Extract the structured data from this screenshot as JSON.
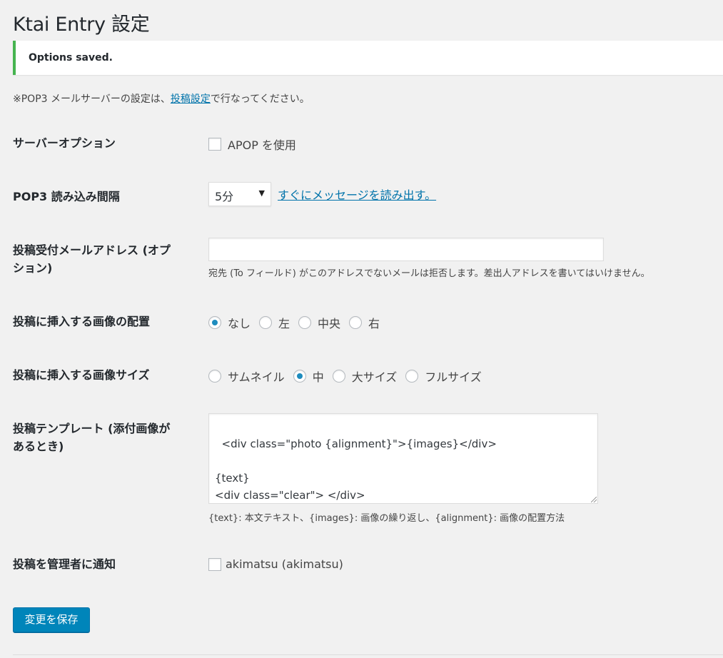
{
  "page": {
    "title": "Ktai Entry 設定"
  },
  "notice": {
    "text": "Options saved."
  },
  "intro": {
    "before": "※POP3 メールサーバーの設定は、",
    "link": "投稿設定",
    "after": "で行なってください。"
  },
  "server_options": {
    "label": "サーバーオプション",
    "apop_label": "APOP を使用",
    "apop_checked": false
  },
  "pop3_interval": {
    "label": "POP3 読み込み間隔",
    "selected": "5分",
    "read_now_link": "すぐにメッセージを読み出す。"
  },
  "post_address": {
    "label_line1": "投稿受付メールアドレス (オプ",
    "label_line2": "ション)",
    "value": "",
    "description": "宛先 (To フィールド) がこのアドレスでないメールは拒否します。差出人アドレスを書いてはいけません。"
  },
  "image_alignment": {
    "label": "投稿に挿入する画像の配置",
    "options": [
      "なし",
      "左",
      "中央",
      "右"
    ],
    "selected": "なし"
  },
  "image_size": {
    "label": "投稿に挿入する画像サイズ",
    "options": [
      "サムネイル",
      "中",
      "大サイズ",
      "フルサイズ"
    ],
    "selected": "中"
  },
  "template": {
    "label_line1": "投稿テンプレート (添付画像が",
    "label_line2": "あるとき)",
    "value": "<div class=\"photo {alignment}\">{images}</div>\n\n{text}\n<div class=\"clear\"> </div>",
    "description": "{text}: 本文テキスト、{images}: 画像の繰り返し、{alignment}: 画像の配置方法"
  },
  "notify_admin": {
    "label": "投稿を管理者に通知",
    "user_label": "akimatsu (akimatsu)",
    "checked": false
  },
  "save_button": {
    "label": "変更を保存"
  },
  "colors": {
    "accent": "#0085ba",
    "link": "#0073aa",
    "success": "#46b450",
    "radio_dot": "#1e8cbe"
  }
}
